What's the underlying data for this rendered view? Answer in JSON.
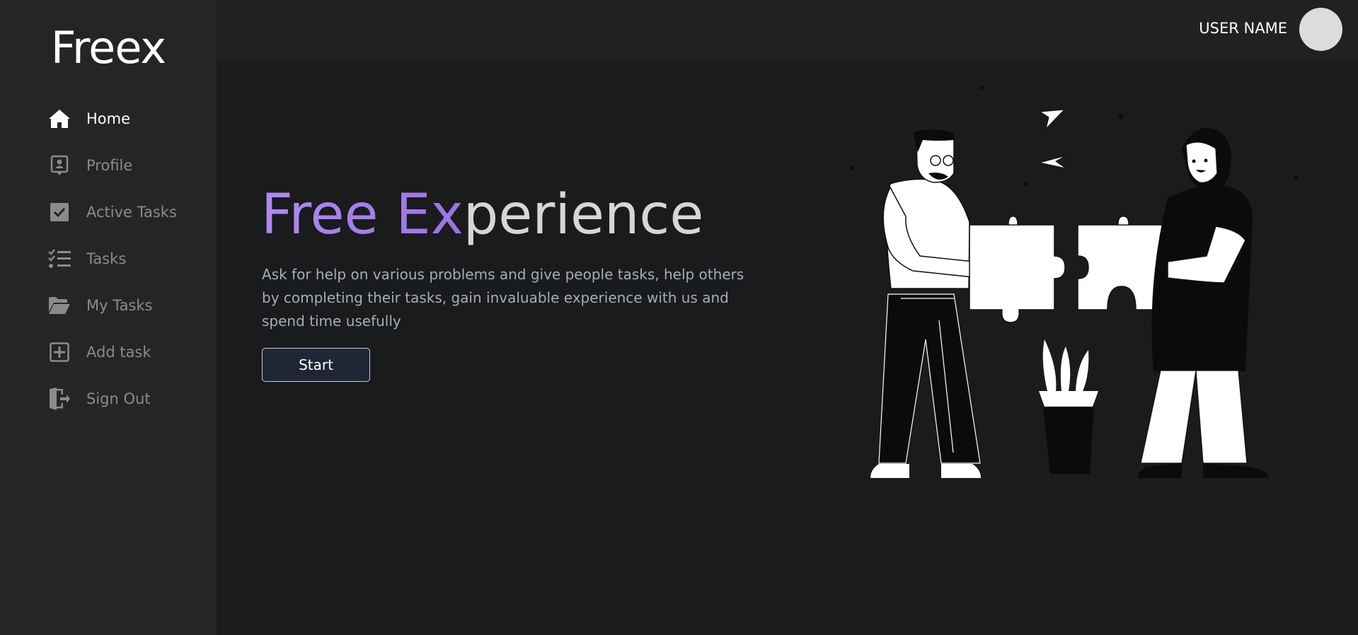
{
  "app": {
    "logo": "Freex"
  },
  "sidebar": {
    "items": [
      {
        "label": "Home",
        "icon": "home-icon",
        "active": true
      },
      {
        "label": "Profile",
        "icon": "profile-icon",
        "active": false
      },
      {
        "label": "Active Tasks",
        "icon": "checkbox-icon",
        "active": false
      },
      {
        "label": "Tasks",
        "icon": "task-list-icon",
        "active": false
      },
      {
        "label": "My Tasks",
        "icon": "folder-open-icon",
        "active": false
      },
      {
        "label": "Add task",
        "icon": "plus-square-icon",
        "active": false
      },
      {
        "label": "Sign Out",
        "icon": "sign-out-icon",
        "active": false
      }
    ]
  },
  "header": {
    "username": "USER NAME"
  },
  "hero": {
    "title_accent": "Free Ex",
    "title_rest": "perience",
    "description": "Ask for help on various problems and give people tasks, help others by completing their tasks, gain invaluable experience with us and spend time usefully",
    "start_label": "Start"
  },
  "colors": {
    "sidebar_bg": "#252526",
    "page_bg": "#1a1b1d",
    "accent": "#a883ec",
    "button_bg": "#1f2636"
  }
}
